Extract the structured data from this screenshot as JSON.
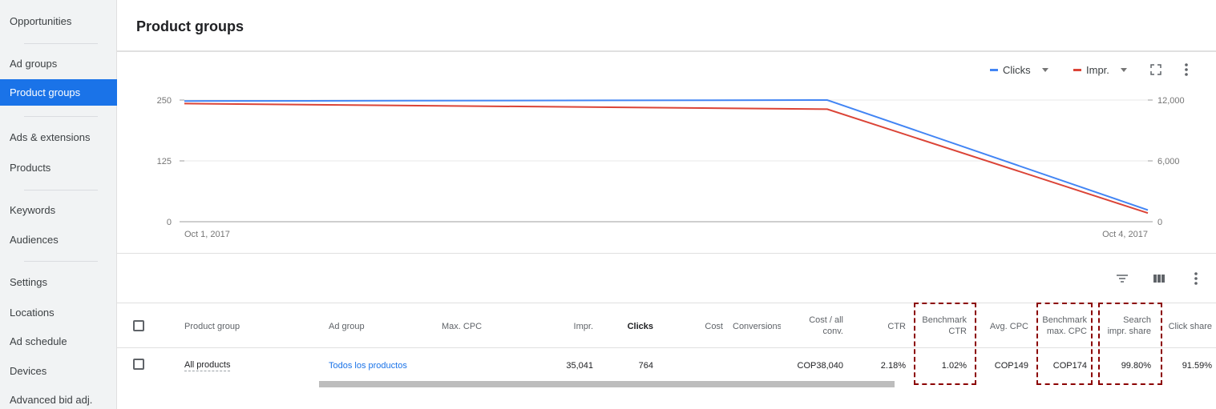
{
  "sidebar": {
    "items": [
      {
        "label": "Opportunities",
        "active": false
      },
      {
        "label": "Ad groups",
        "active": false
      },
      {
        "label": "Product groups",
        "active": true
      },
      {
        "label": "Ads & extensions",
        "active": false
      },
      {
        "label": "Products",
        "active": false
      },
      {
        "label": "Keywords",
        "active": false
      },
      {
        "label": "Audiences",
        "active": false
      },
      {
        "label": "Settings",
        "active": false
      },
      {
        "label": "Locations",
        "active": false
      },
      {
        "label": "Ad schedule",
        "active": false
      },
      {
        "label": "Devices",
        "active": false
      },
      {
        "label": "Advanced bid adj.",
        "active": false
      }
    ]
  },
  "header": {
    "title": "Product groups"
  },
  "chart_controls": {
    "metric1": {
      "label": "Clicks",
      "color": "#4285f4"
    },
    "metric2": {
      "label": "Impr.",
      "color": "#db4437"
    },
    "icons": [
      "fullscreen-icon",
      "more-vert-icon"
    ]
  },
  "chart_data": {
    "type": "line",
    "x": [
      "Oct 1, 2017",
      "Oct 3, 2017",
      "Oct 4, 2017"
    ],
    "x_tick_labels": [
      "Oct 1, 2017",
      "Oct 4, 2017"
    ],
    "y_left": {
      "ticks": [
        "0",
        "125",
        "250"
      ],
      "range": [
        0,
        250
      ]
    },
    "y_right": {
      "ticks": [
        "0",
        "6,000",
        "12,000"
      ],
      "range": [
        0,
        12000
      ]
    },
    "series": [
      {
        "name": "Clicks",
        "axis": "left",
        "color": "#4285f4",
        "values": [
          248,
          250,
          24
        ]
      },
      {
        "name": "Impr.",
        "axis": "right",
        "color": "#db4437",
        "values": [
          11650,
          11100,
          850
        ]
      }
    ],
    "grid": true,
    "legend": "top-right"
  },
  "table_toolbar": {
    "icons": [
      "filter-icon",
      "columns-icon",
      "more-vert-icon"
    ]
  },
  "table": {
    "headers": {
      "product_group": "Product group",
      "ad_group": "Ad group",
      "max_cpc": "Max. CPC",
      "impr": "Impr.",
      "clicks": "Clicks",
      "cost": "Cost",
      "conversions": "Conversions",
      "cost_conv_1": "Cost / all",
      "cost_conv_2": "conv.",
      "ctr": "CTR",
      "bench_ctr_1": "Benchmark",
      "bench_ctr_2": "CTR",
      "avg_cpc": "Avg. CPC",
      "bench_cpc_1": "Benchmark",
      "bench_cpc_2": "max. CPC",
      "search_share_1": "Search",
      "search_share_2": "impr. share",
      "click_share": "Click share"
    },
    "row": {
      "product_group": "All products",
      "ad_group": "Todos los productos",
      "max_cpc": "",
      "impr": "35,041",
      "clicks": "764",
      "cost": "",
      "conversions": "",
      "cost_conv": "COP38,040",
      "ctr": "2.18%",
      "bench_ctr": "1.02%",
      "avg_cpc": "COP149",
      "bench_cpc": "COP174",
      "search_share": "99.80%",
      "click_share": "91.59%"
    }
  }
}
